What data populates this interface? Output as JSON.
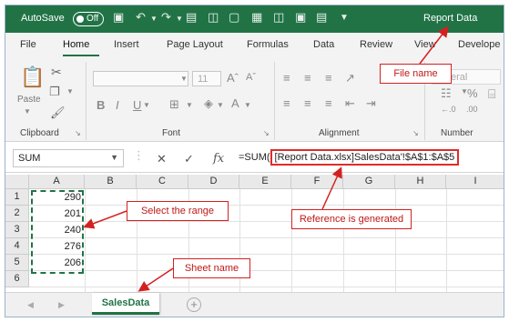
{
  "titlebar": {
    "autosave_label": "AutoSave",
    "autosave_state": "Off",
    "workbook_title": "Report Data"
  },
  "tabs": [
    "File",
    "Home",
    "Insert",
    "Page Layout",
    "Formulas",
    "Data",
    "Review",
    "View",
    "Develope"
  ],
  "active_tab": "Home",
  "ribbon": {
    "clipboard": {
      "label": "Clipboard",
      "paste_label": "Paste"
    },
    "font": {
      "label": "Font",
      "size": "11"
    },
    "alignment": {
      "label": "Alignment"
    },
    "number": {
      "label": "Number",
      "format": "eral"
    }
  },
  "formula_bar": {
    "name_box": "SUM",
    "fx_symbol": "fx",
    "formula_prefix": "=SUM(",
    "formula_reference": "[Report Data.xlsx]SalesData'!$A$1:$A$5"
  },
  "grid": {
    "columns": [
      "A",
      "B",
      "C",
      "D",
      "E",
      "F",
      "G",
      "H",
      "I"
    ],
    "rows": [
      "1",
      "2",
      "3",
      "4",
      "5",
      "6"
    ],
    "column_a_values": [
      "290",
      "201",
      "240",
      "276",
      "206"
    ]
  },
  "sheet_tabs": {
    "active": "SalesData"
  },
  "annotations": {
    "file_name": "File name",
    "select_range": "Select the range",
    "reference_generated": "Reference is generated",
    "sheet_name": "Sheet name"
  },
  "colors": {
    "excel_green": "#217346",
    "annotation_red": "#d42020"
  }
}
